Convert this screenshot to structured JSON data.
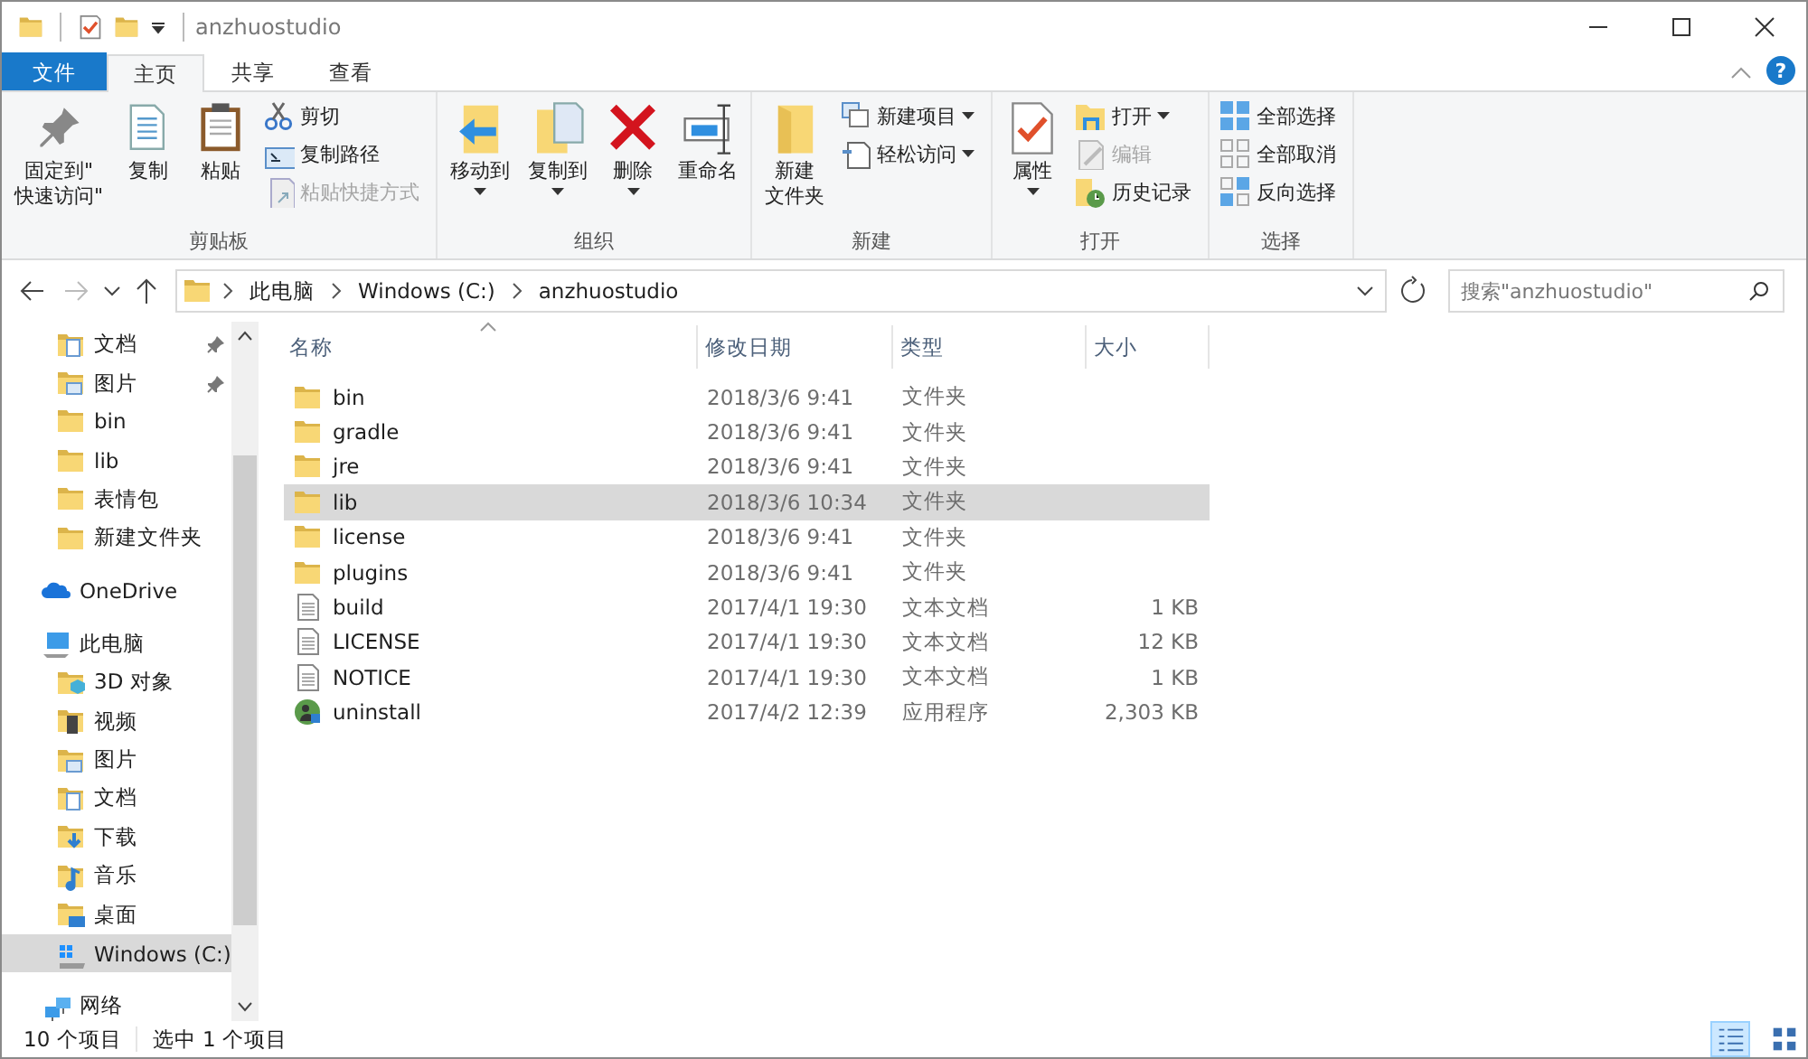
{
  "window": {
    "title": "anzhuostudio"
  },
  "ribbon_tabs": [
    {
      "label": "文件",
      "kind": "file",
      "selected": false
    },
    {
      "label": "主页",
      "kind": "tab",
      "selected": true
    },
    {
      "label": "共享",
      "kind": "tab",
      "selected": false
    },
    {
      "label": "查看",
      "kind": "tab",
      "selected": false
    }
  ],
  "help": "?",
  "ribbon": [
    {
      "label": "剪贴板",
      "items": [
        {
          "kind": "large",
          "label": [
            "固定到\"",
            "快速访问\""
          ],
          "disabled": false,
          "dropdown": false
        },
        {
          "kind": "large",
          "label": [
            "复制"
          ],
          "disabled": false,
          "dropdown": false
        },
        {
          "kind": "large",
          "label": [
            "粘贴"
          ],
          "disabled": false,
          "dropdown": false
        },
        {
          "kind": "small",
          "label": "剪切",
          "disabled": false,
          "dropdown": false
        },
        {
          "kind": "small",
          "label": "复制路径",
          "disabled": false,
          "dropdown": false
        },
        {
          "kind": "small",
          "label": "粘贴快捷方式",
          "disabled": true,
          "dropdown": false
        }
      ]
    },
    {
      "label": "组织",
      "items": [
        {
          "kind": "large",
          "label": [
            "移动到"
          ],
          "disabled": false,
          "dropdown": true
        },
        {
          "kind": "large",
          "label": [
            "复制到"
          ],
          "disabled": false,
          "dropdown": true
        },
        {
          "kind": "large",
          "label": [
            "删除"
          ],
          "disabled": false,
          "dropdown": true
        },
        {
          "kind": "large",
          "label": [
            "重命名"
          ],
          "disabled": false,
          "dropdown": false
        }
      ]
    },
    {
      "label": "新建",
      "items": [
        {
          "kind": "large",
          "label": [
            "新建",
            "文件夹"
          ],
          "disabled": false,
          "dropdown": false
        },
        {
          "kind": "small",
          "label": "新建项目",
          "disabled": false,
          "dropdown": true
        },
        {
          "kind": "small",
          "label": "轻松访问",
          "disabled": false,
          "dropdown": true
        }
      ]
    },
    {
      "label": "打开",
      "items": [
        {
          "kind": "large",
          "label": [
            "属性"
          ],
          "disabled": false,
          "dropdown": true
        },
        {
          "kind": "small",
          "label": "打开",
          "disabled": false,
          "dropdown": true
        },
        {
          "kind": "small",
          "label": "编辑",
          "disabled": true,
          "dropdown": false
        },
        {
          "kind": "small",
          "label": "历史记录",
          "disabled": false,
          "dropdown": false
        }
      ]
    },
    {
      "label": "选择",
      "items": [
        {
          "kind": "small",
          "label": "全部选择",
          "disabled": false,
          "dropdown": false
        },
        {
          "kind": "small",
          "label": "全部取消",
          "disabled": false,
          "dropdown": false
        },
        {
          "kind": "small",
          "label": "反向选择",
          "disabled": false,
          "dropdown": false
        }
      ]
    }
  ],
  "address_bar": {
    "segments": [
      "此电脑",
      "Windows (C:)",
      "anzhuostudio"
    ]
  },
  "search": {
    "placeholder": "搜索\"anzhuostudio\""
  },
  "sidebar": {
    "quick_access": [
      {
        "label": "文档",
        "kind": "docs",
        "pinned": true
      },
      {
        "label": "图片",
        "kind": "pictures",
        "pinned": true
      },
      {
        "label": "bin",
        "kind": "folder",
        "pinned": false
      },
      {
        "label": "lib",
        "kind": "folder",
        "pinned": false
      },
      {
        "label": "表情包",
        "kind": "folder",
        "pinned": false
      },
      {
        "label": "新建文件夹",
        "kind": "folder",
        "pinned": false
      }
    ],
    "roots": [
      {
        "label": "OneDrive",
        "kind": "cloud",
        "selected": false
      },
      {
        "label": "此电脑",
        "kind": "pc",
        "selected": false,
        "children": [
          {
            "label": "3D 对象",
            "kind": "cube",
            "selected": false
          },
          {
            "label": "视频",
            "kind": "video",
            "selected": false
          },
          {
            "label": "图片",
            "kind": "pictures",
            "selected": false
          },
          {
            "label": "文档",
            "kind": "docs",
            "selected": false
          },
          {
            "label": "下载",
            "kind": "download",
            "selected": false
          },
          {
            "label": "音乐",
            "kind": "music",
            "selected": false
          },
          {
            "label": "桌面",
            "kind": "desktop",
            "selected": false
          },
          {
            "label": "Windows (C:)",
            "kind": "drive",
            "selected": true
          }
        ]
      },
      {
        "label": "网络",
        "kind": "network",
        "selected": false
      }
    ]
  },
  "table": {
    "columns": [
      "名称",
      "修改日期",
      "类型",
      "大小"
    ],
    "rows": [
      {
        "name": "bin",
        "date": "2018/3/6 9:41",
        "type": "文件夹",
        "kind": "folder",
        "selected": false
      },
      {
        "name": "gradle",
        "date": "2018/3/6 9:41",
        "type": "文件夹",
        "kind": "folder",
        "selected": false
      },
      {
        "name": "jre",
        "date": "2018/3/6 9:41",
        "type": "文件夹",
        "kind": "folder",
        "selected": false
      },
      {
        "name": "lib",
        "date": "2018/3/6 10:34",
        "type": "文件夹",
        "kind": "folder",
        "selected": true
      },
      {
        "name": "license",
        "date": "2018/3/6 9:41",
        "type": "文件夹",
        "kind": "folder",
        "selected": false
      },
      {
        "name": "plugins",
        "date": "2018/3/6 9:41",
        "type": "文件夹",
        "kind": "folder",
        "selected": false
      },
      {
        "name": "build",
        "date": "2017/4/1 19:30",
        "type": "文本文档",
        "size": "1 KB",
        "kind": "text",
        "selected": false
      },
      {
        "name": "LICENSE",
        "date": "2017/4/1 19:30",
        "type": "文本文档",
        "size": "12 KB",
        "kind": "text",
        "selected": false
      },
      {
        "name": "NOTICE",
        "date": "2017/4/1 19:30",
        "type": "文本文档",
        "size": "1 KB",
        "kind": "text",
        "selected": false
      },
      {
        "name": "uninstall",
        "date": "2017/4/2 12:39",
        "type": "应用程序",
        "size": "2,303 KB",
        "kind": "app",
        "selected": false
      }
    ]
  },
  "status_bar": {
    "count": "10 个项目",
    "selection": "选中 1 个项目",
    "views": [
      {
        "kind": "details",
        "selected": true
      },
      {
        "kind": "large_icons",
        "selected": false
      }
    ]
  }
}
